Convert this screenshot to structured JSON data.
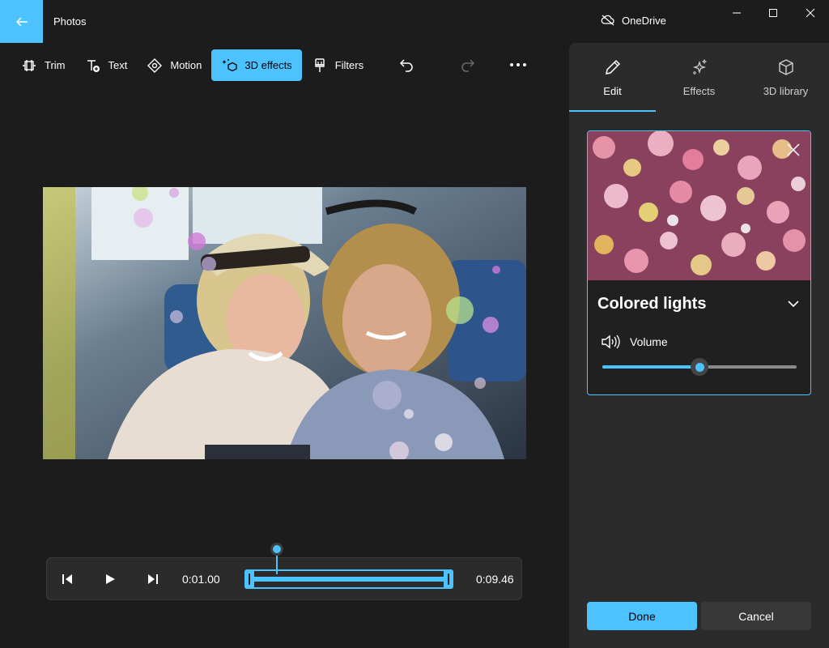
{
  "title_bar": {
    "app_title": "Photos",
    "onedrive_label": "OneDrive",
    "icons": [
      "back-arrow-icon",
      "cloud-off-icon",
      "minimize-icon",
      "maximize-icon",
      "close-icon"
    ]
  },
  "toolbar": {
    "items": [
      {
        "label": "Trim",
        "icon": "trim-icon",
        "active": false
      },
      {
        "label": "Text",
        "icon": "text-add-icon",
        "active": false
      },
      {
        "label": "Motion",
        "icon": "motion-icon",
        "active": false
      },
      {
        "label": "3D effects",
        "icon": "3d-effects-icon",
        "active": true
      },
      {
        "label": "Filters",
        "icon": "filters-brush-icon",
        "active": false
      }
    ],
    "undo_icon": "undo-icon",
    "redo_icon": "redo-icon",
    "more_icon": "more-horizontal-icon"
  },
  "preview": {
    "description_icon": "video-frame"
  },
  "timeline": {
    "current_time": "0:01.00",
    "end_time": "0:09.46"
  },
  "panel": {
    "tabs": [
      {
        "label": "Edit",
        "icon": "pencil-icon",
        "active": true
      },
      {
        "label": "Effects",
        "icon": "sparkle-icon",
        "active": false
      },
      {
        "label": "3D library",
        "icon": "cube-icon",
        "active": false
      }
    ],
    "effect": {
      "name": "Colored lights",
      "volume_label": "Volume",
      "volume_level": 0.5
    },
    "done_label": "Done",
    "cancel_label": "Cancel"
  },
  "colors": {
    "accent": "#4cc2ff",
    "background": "#1c1c1c",
    "panel": "#2b2b2b"
  }
}
